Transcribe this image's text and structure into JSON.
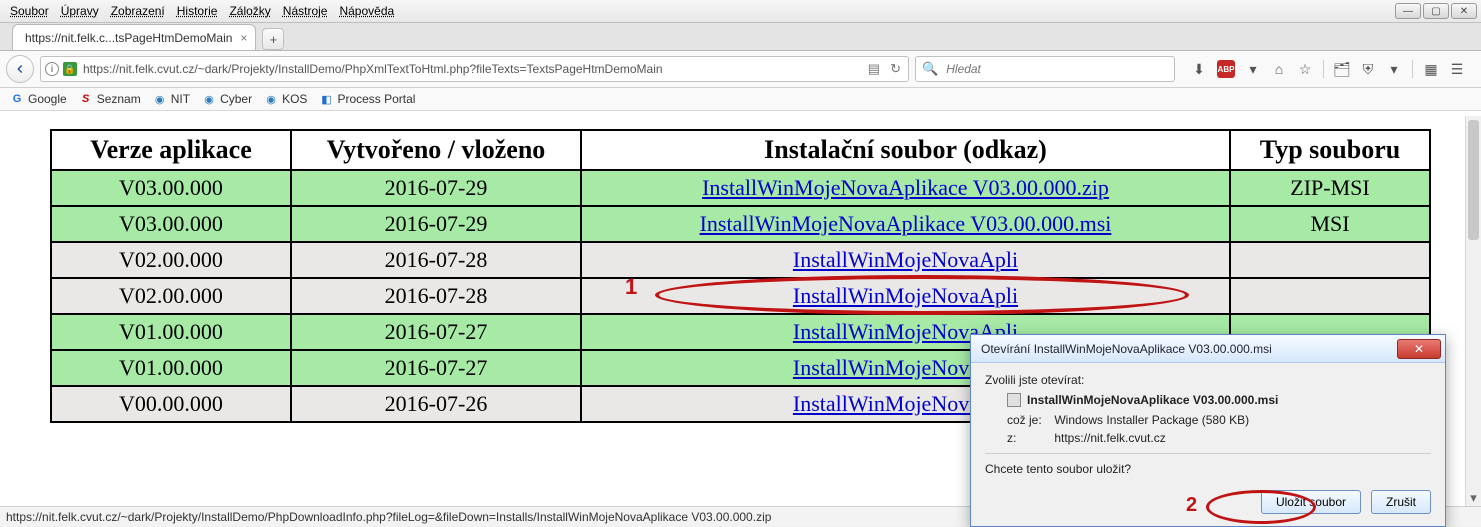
{
  "menu": {
    "items": [
      "Soubor",
      "Úpravy",
      "Zobrazení",
      "Historie",
      "Záložky",
      "Nástroje",
      "Nápověda"
    ]
  },
  "tab": {
    "title": "https://nit.felk.c...tsPageHtmDemoMain"
  },
  "address": {
    "url": "https://nit.felk.cvut.cz/~dark/Projekty/InstallDemo/PhpXmlTextToHtml.php?fileTexts=TextsPageHtmDemoMain"
  },
  "search": {
    "placeholder": "Hledat"
  },
  "bookmarks": [
    {
      "label": "Google",
      "icon": "G",
      "color": "#1a73e8"
    },
    {
      "label": "Seznam",
      "icon": "S",
      "color": "#cc0000"
    },
    {
      "label": "NIT",
      "icon": "◉",
      "color": "#777"
    },
    {
      "label": "Cyber",
      "icon": "◉",
      "color": "#777"
    },
    {
      "label": "KOS",
      "icon": "◉",
      "color": "#777"
    },
    {
      "label": "Process Portal",
      "icon": "◧",
      "color": "#1f6fd0"
    }
  ],
  "table": {
    "headers": [
      "Verze aplikace",
      "Vytvořeno / vloženo",
      "Instalační soubor (odkaz)",
      "Typ souboru"
    ],
    "rows": [
      {
        "ver": "V03.00.000",
        "date": "2016-07-29",
        "file": "InstallWinMojeNovaAplikace V03.00.000.zip",
        "type": "ZIP-MSI",
        "parity": "even"
      },
      {
        "ver": "V03.00.000",
        "date": "2016-07-29",
        "file": "InstallWinMojeNovaAplikace V03.00.000.msi",
        "type": "MSI",
        "parity": "even"
      },
      {
        "ver": "V02.00.000",
        "date": "2016-07-28",
        "file": "InstallWinMojeNovaApli",
        "type": "",
        "parity": "odd"
      },
      {
        "ver": "V02.00.000",
        "date": "2016-07-28",
        "file": "InstallWinMojeNovaApli",
        "type": "",
        "parity": "odd"
      },
      {
        "ver": "V01.00.000",
        "date": "2016-07-27",
        "file": "InstallWinMojeNovaApli",
        "type": "",
        "parity": "even"
      },
      {
        "ver": "V01.00.000",
        "date": "2016-07-27",
        "file": "InstallWinMojeNovaApli",
        "type": "",
        "parity": "even"
      },
      {
        "ver": "V00.00.000",
        "date": "2016-07-26",
        "file": "InstallWinMojeNovaApli",
        "type": "",
        "parity": "odd"
      }
    ]
  },
  "annotations": {
    "one": "1",
    "two": "2"
  },
  "dialog": {
    "title": "Otevírání InstallWinMojeNovaAplikace V03.00.000.msi",
    "intro": "Zvolili jste otevírat:",
    "filename": "InstallWinMojeNovaAplikace V03.00.000.msi",
    "kind_label": "což je:",
    "kind_value": "Windows Installer Package (580 KB)",
    "from_label": "z:",
    "from_value": "https://nit.felk.cvut.cz",
    "question": "Chcete tento soubor uložit?",
    "save": "Uložit soubor",
    "cancel": "Zrušit"
  },
  "status": {
    "text": "https://nit.felk.cvut.cz/~dark/Projekty/InstallDemo/PhpDownloadInfo.php?fileLog=&fileDown=Installs/InstallWinMojeNovaAplikace V03.00.000.zip"
  }
}
